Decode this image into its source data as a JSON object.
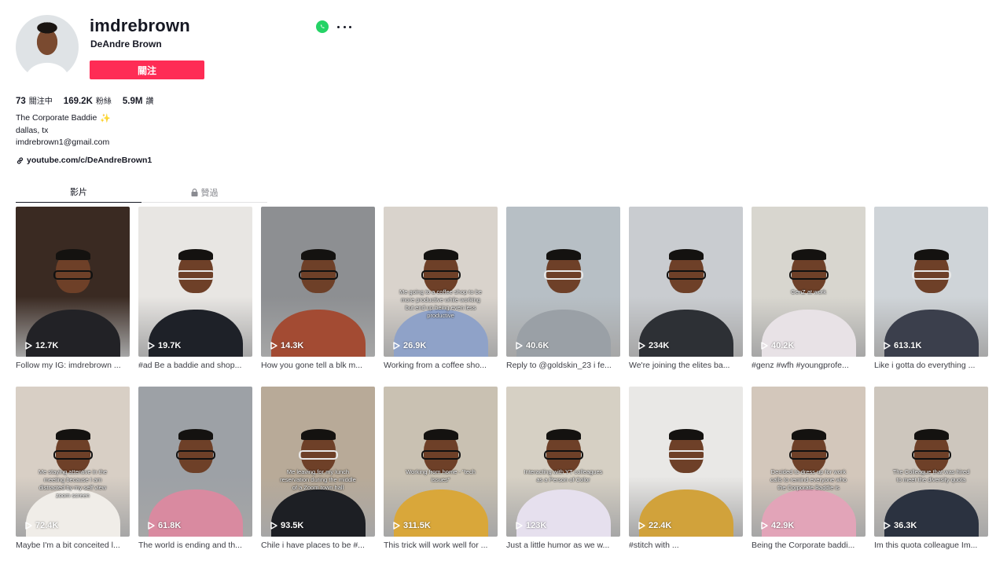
{
  "profile": {
    "username": "imdrebrown",
    "display_name": "DeAndre Brown",
    "follow_label": "關注",
    "stats": [
      {
        "value": "73",
        "label": "關注中"
      },
      {
        "value": "169.2K",
        "label": "粉絲"
      },
      {
        "value": "5.9M",
        "label": "讚"
      }
    ],
    "bio_title": "The Corporate Baddie",
    "bio_emoji": "✨",
    "bio_location": "dallas, tx",
    "bio_email": "imdrebrown1@gmail.com",
    "link": "youtube.com/c/DeAndreBrown1",
    "share_icon": "whatsapp-icon",
    "more_icon": "more-options-icon"
  },
  "tabs": [
    {
      "label": "影片",
      "active": true
    },
    {
      "label": "贊過",
      "active": false,
      "icon": "lock-icon"
    }
  ],
  "videos": [
    {
      "views": "12.7K",
      "desc": "Follow my IG: imdrebrown ...",
      "caption": "",
      "bg": "#3a2a22",
      "body": "#222226"
    },
    {
      "views": "19.7K",
      "desc": "#ad Be a baddie and shop...",
      "caption": "",
      "bg": "#e8e6e3",
      "body": "#1e2128"
    },
    {
      "views": "14.3K",
      "desc": "How you gone tell a blk m...",
      "caption": "",
      "bg": "#8d8f92",
      "body": "#a34b33"
    },
    {
      "views": "26.9K",
      "desc": "Working from a coffee sho...",
      "caption": "Me going to a coffee shop to be more productive while working but end up being even less productive",
      "bg": "#d9d3cc",
      "body": "#8fa2c8"
    },
    {
      "views": "40.6K",
      "desc": "Reply to @goldskin_23 i fe...",
      "caption": "",
      "bg": "#b7bfc5",
      "body": "#9aa0a6"
    },
    {
      "views": "234K",
      "desc": "We're joining the elites ba...",
      "caption": "",
      "bg": "#c9ccd0",
      "body": "#2d3035"
    },
    {
      "views": "40.2K",
      "desc": "#genz #wfh #youngprofe...",
      "caption": "GenZ at work",
      "bg": "#d8d6cf",
      "body": "#e8e2e6"
    },
    {
      "views": "613.1K",
      "desc": "Like i gotta do everything ...",
      "caption": "",
      "bg": "#cfd4d8",
      "body": "#3b3f4c"
    },
    {
      "views": "72.4K",
      "desc": "Maybe I'm a bit conceited l...",
      "caption": "Me staying attentive in the meeting because I am distracted by my self view zoom screen",
      "bg": "#d8cfc5",
      "body": "#f0ede8"
    },
    {
      "views": "61.8K",
      "desc": "The world is ending and th...",
      "caption": "",
      "bg": "#9da1a6",
      "body": "#d98aa0"
    },
    {
      "views": "93.5K",
      "desc": "Chile i have places to be #...",
      "caption": "Me leaving for my lunch reservation during the middle of a Zoom town hall",
      "bg": "#b8aa98",
      "body": "#1d1f24"
    },
    {
      "views": "311.5K",
      "desc": "This trick will work well for ...",
      "caption": "Working from home - \"tech issues\"",
      "bg": "#c9c1b2",
      "body": "#d9a73a"
    },
    {
      "views": "123K",
      "desc": "Just a little humor as we w...",
      "caption": "Interacting with YT colleagues as a Person of Color",
      "bg": "#d6d0c4",
      "body": "#e6e0ee"
    },
    {
      "views": "22.4K",
      "desc": "#stitch with ...",
      "caption": "",
      "bg": "#e9e8e6",
      "body": "#d1a23b"
    },
    {
      "views": "42.9K",
      "desc": "Being the Corporate baddi...",
      "caption": "Decided to dress up for work calls to remind everyone who the Corporate Baddie is",
      "bg": "#d3c7bb",
      "body": "#e2a4b8"
    },
    {
      "views": "36.3K",
      "desc": "Im this quota colleague Im...",
      "caption": "The Colleague that was hired to meet the diversity quota",
      "bg": "#cdc6bd",
      "body": "#2b3240"
    }
  ]
}
